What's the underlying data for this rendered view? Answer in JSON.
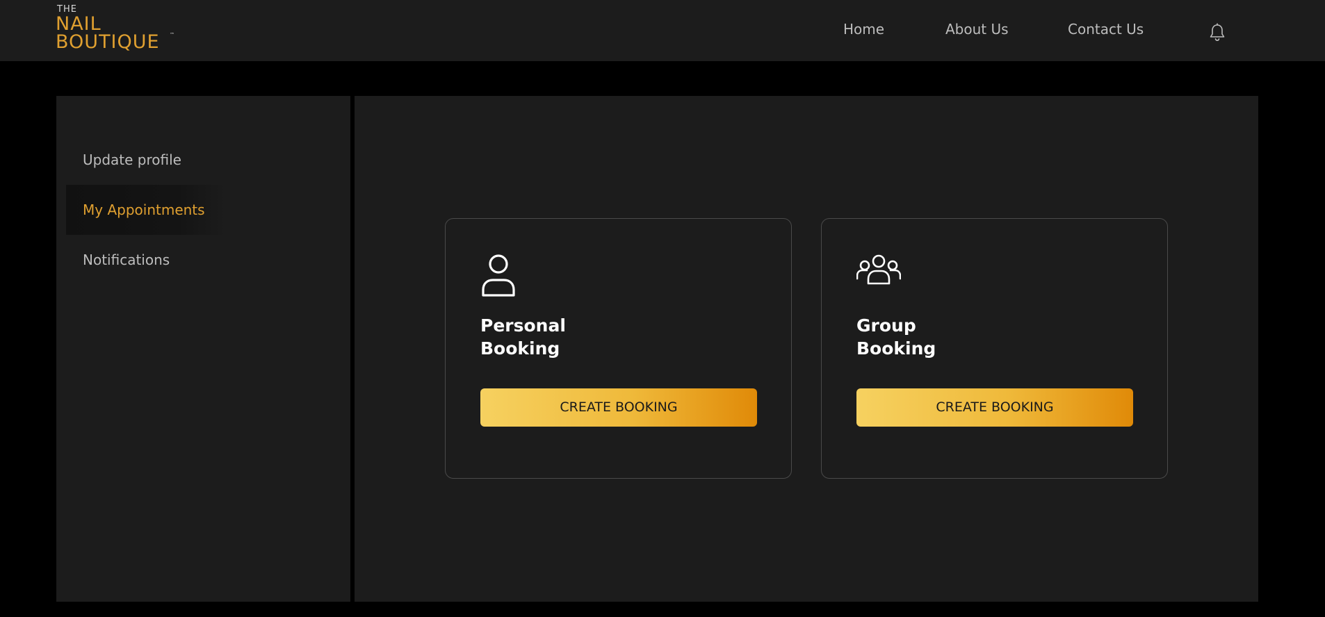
{
  "brand": {
    "the": "THE",
    "line1": "NAIL",
    "line2": "BOUTIQUE",
    "tm": "™"
  },
  "nav": {
    "home": "Home",
    "about": "About Us",
    "contact": "Contact Us",
    "bell_icon": "bell-icon"
  },
  "sidebar": {
    "items": [
      {
        "label": "Update profile",
        "active": false
      },
      {
        "label": "My Appointments",
        "active": true
      },
      {
        "label": "Notifications",
        "active": false
      }
    ]
  },
  "cards": [
    {
      "title_line1": "Personal",
      "title_line2": "Booking",
      "button": "CREATE BOOKING",
      "icon": "user-icon"
    },
    {
      "title_line1": "Group",
      "title_line2": "Booking",
      "button": "CREATE BOOKING",
      "icon": "group-icon"
    }
  ],
  "colors": {
    "accent": "#e0a030",
    "background": "#000000",
    "panel": "#1c1c1c",
    "button_gradient_start": "#f6d160",
    "button_gradient_end": "#e08a08"
  }
}
